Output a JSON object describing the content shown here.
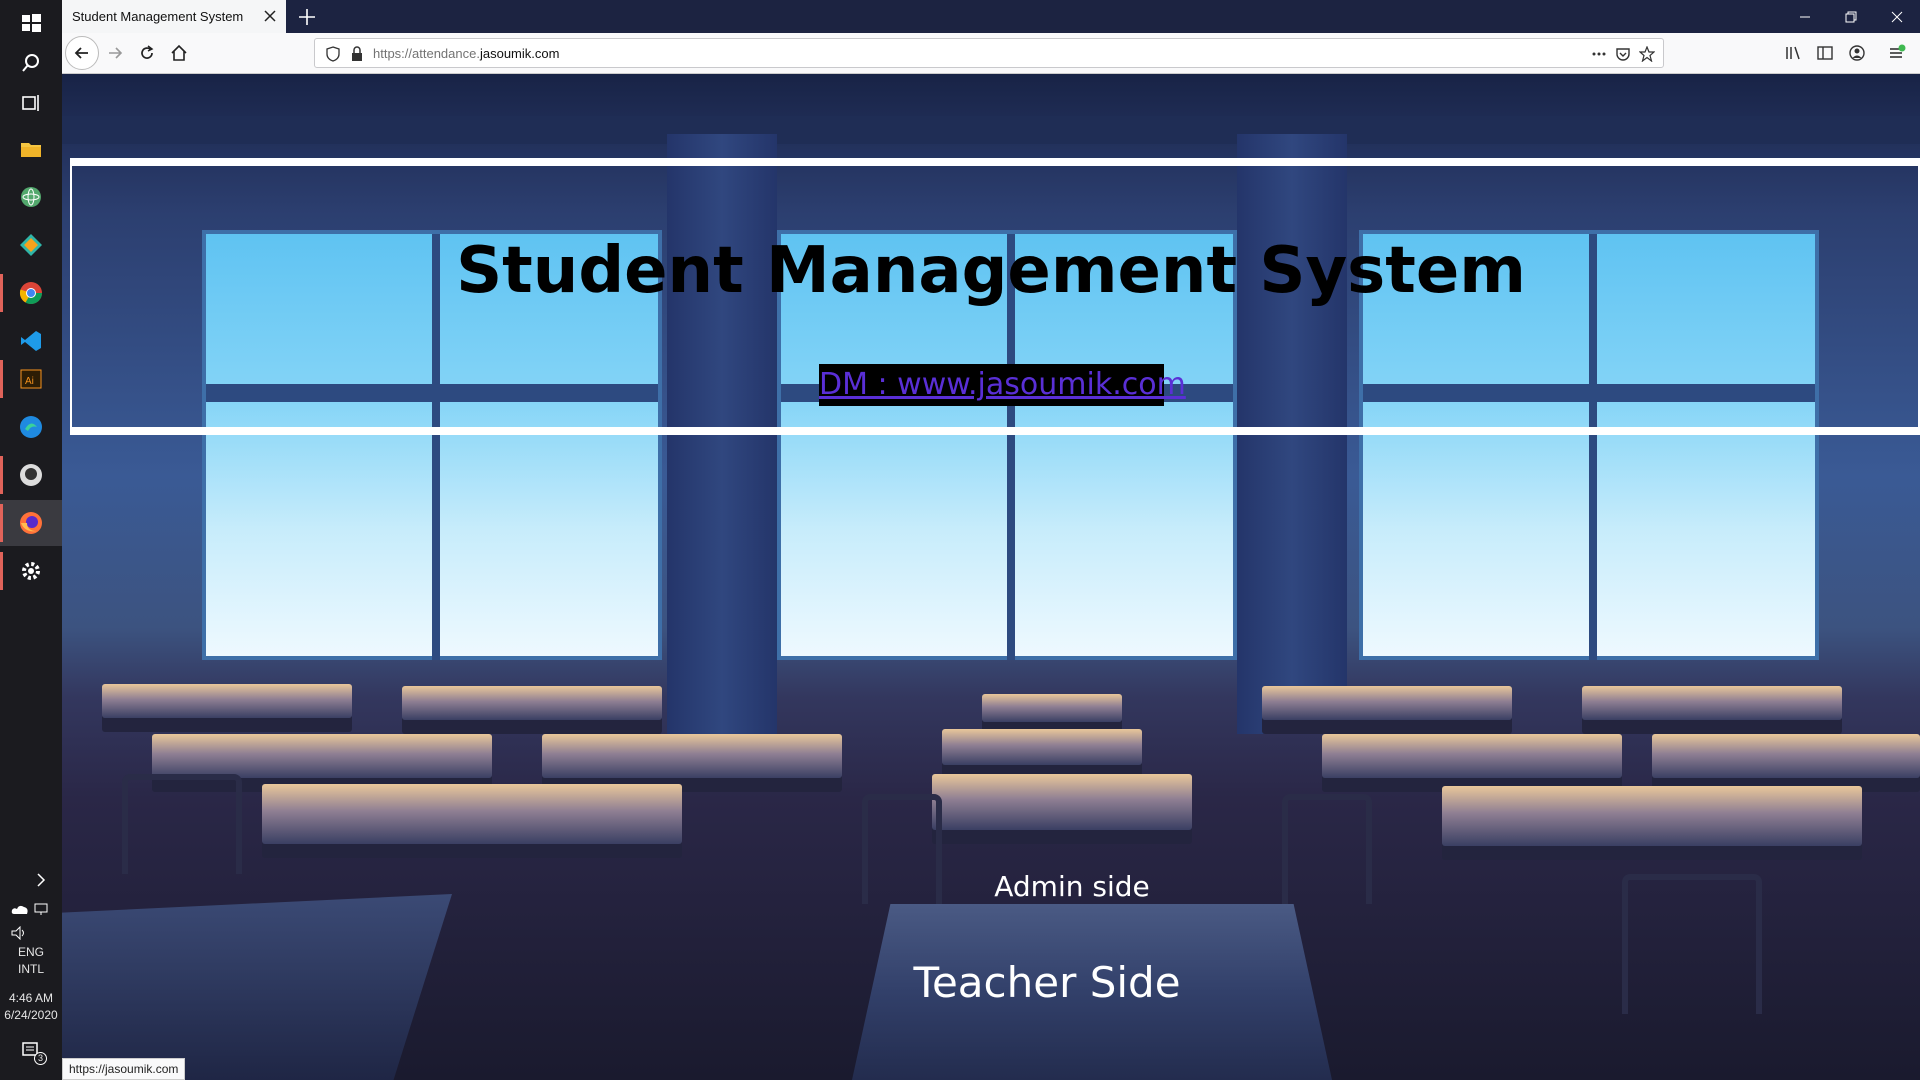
{
  "browser": {
    "tab_title": "Student Management System",
    "url_scheme_sub": "https://attendance.",
    "url_host": "jasoumik.com",
    "status_url": "https://jasoumik.com"
  },
  "taskbar": {
    "items": [
      "windows-logo",
      "search",
      "task-view",
      "file-explorer",
      "atom",
      "git-kraken",
      "chrome",
      "vscode",
      "illustrator",
      "edge",
      "github",
      "firefox",
      "settings"
    ],
    "tray": {
      "language_line1": "ENG",
      "language_line2": "INTL",
      "time": "4:46 AM",
      "date": "6/24/2020",
      "notification_count": "3"
    }
  },
  "page": {
    "title": "Student Management System",
    "dm_link": "DM : www.jasoumik.com",
    "admin_link": "Admin side",
    "teacher_link": "Teacher Side"
  },
  "colors": {
    "link_purple": "#5a2fd6",
    "tab_bar": "#1c2341",
    "active_indicator": "#e0635a"
  }
}
